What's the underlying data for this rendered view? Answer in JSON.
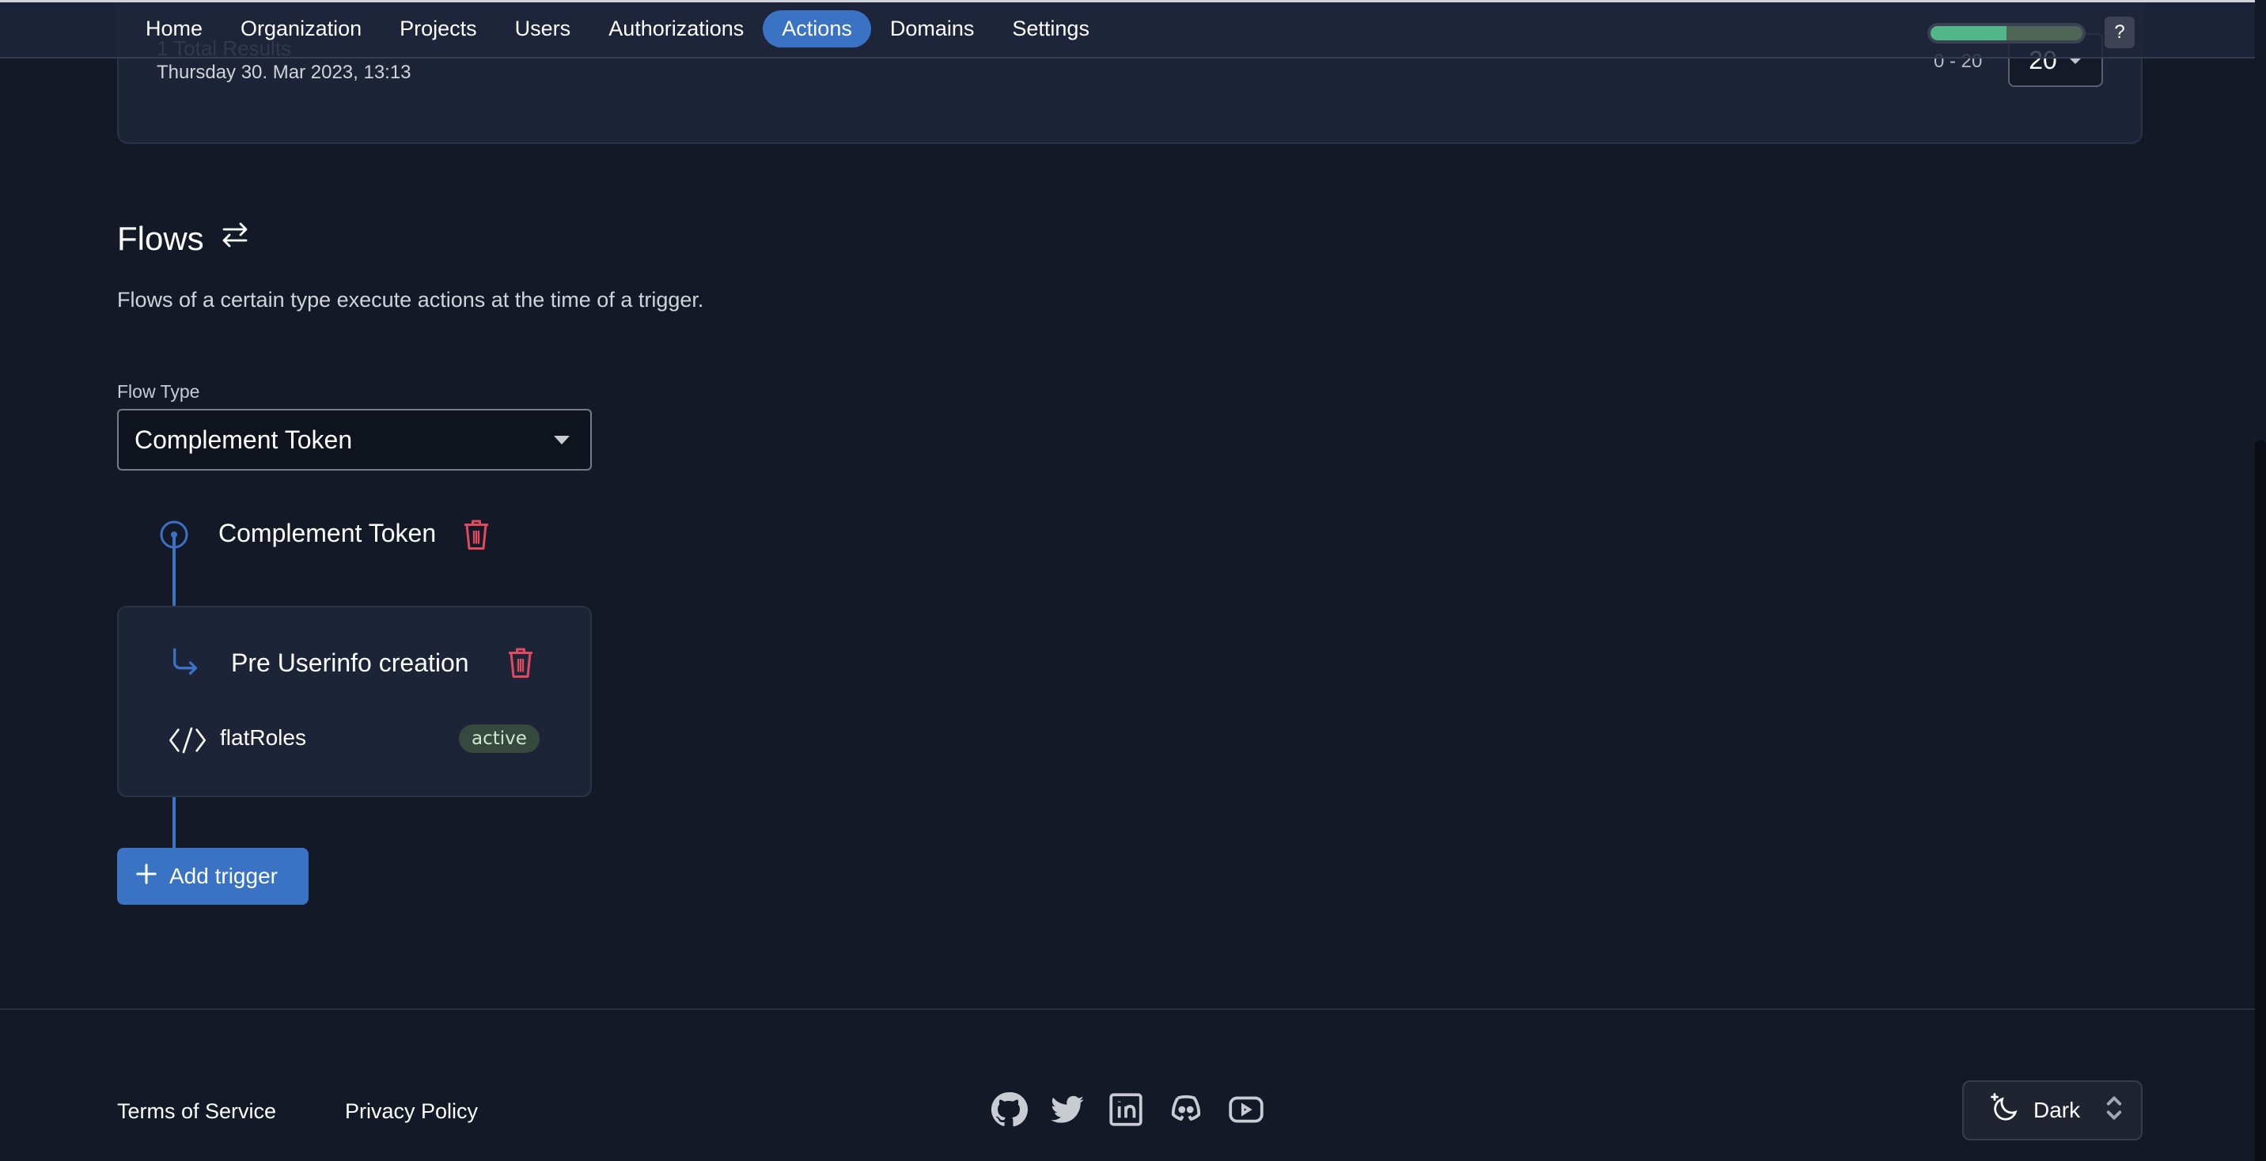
{
  "nav": {
    "items": [
      {
        "label": "Home",
        "active": false
      },
      {
        "label": "Organization",
        "active": false
      },
      {
        "label": "Projects",
        "active": false
      },
      {
        "label": "Users",
        "active": false
      },
      {
        "label": "Authorizations",
        "active": false
      },
      {
        "label": "Actions",
        "active": true
      },
      {
        "label": "Domains",
        "active": false
      },
      {
        "label": "Settings",
        "active": false
      }
    ],
    "quota_progress_percent": 50,
    "help_label": "?"
  },
  "results": {
    "total": "1 Total Results",
    "date": "Thursday 30. Mar 2023, 13:13",
    "range": "0 - 20",
    "page_size": "20"
  },
  "flows": {
    "title": "Flows",
    "title_icon": "swap-arrows-icon",
    "description": "Flows of a certain type execute actions at the time of a trigger.",
    "flow_type_label": "Flow Type",
    "flow_type_value": "Complement Token",
    "root_name": "Complement Token",
    "triggers": [
      {
        "name": "Pre Userinfo creation",
        "actions": [
          {
            "name": "flatRoles",
            "status": "active"
          }
        ]
      }
    ],
    "add_trigger_label": "Add trigger"
  },
  "footer": {
    "terms": "Terms of Service",
    "privacy": "Privacy Policy",
    "social": [
      "github-icon",
      "twitter-icon",
      "linkedin-icon",
      "discord-icon",
      "youtube-icon"
    ],
    "theme": "Dark"
  },
  "colors": {
    "accent": "#3a72c4",
    "danger": "#e04a5f",
    "success": "#52b788",
    "background": "#131927",
    "card": "#1d2438"
  }
}
